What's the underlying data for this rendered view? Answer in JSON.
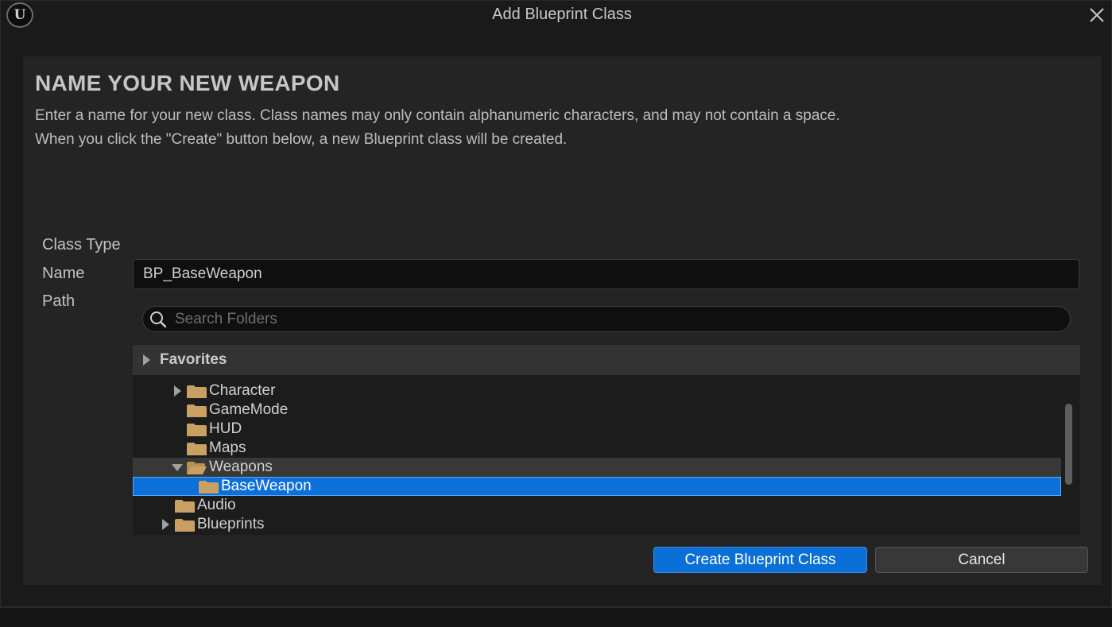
{
  "window": {
    "title": "Add Blueprint Class",
    "logo": "unreal-engine-logo",
    "logo_glyph": "U"
  },
  "content": {
    "heading": "NAME YOUR NEW WEAPON",
    "description_line1": "Enter a name for your new class. Class names may only contain alphanumeric characters, and may not contain a space.",
    "description_line2": "When you click the \"Create\" button below, a new Blueprint class will be created."
  },
  "form": {
    "class_type_label": "Class Type",
    "name_label": "Name",
    "name_value": "BP_BaseWeapon",
    "path_label": "Path",
    "search_placeholder": "Search Folders"
  },
  "tree": {
    "favorites_label": "Favorites",
    "items": [
      {
        "label": "Character",
        "expandable": true,
        "expanded": false
      },
      {
        "label": "GameMode",
        "expandable": false
      },
      {
        "label": "HUD",
        "expandable": false
      },
      {
        "label": "Maps",
        "expandable": false
      },
      {
        "label": "Weapons",
        "expandable": true,
        "expanded": true
      },
      {
        "label": "BaseWeapon",
        "expandable": false,
        "selected": true
      },
      {
        "label": "Audio",
        "expandable": false
      },
      {
        "label": "Blueprints",
        "expandable": true,
        "expanded": false
      }
    ]
  },
  "buttons": {
    "create_label": "Create Blueprint Class",
    "cancel_label": "Cancel"
  },
  "colors": {
    "accent": "#0a6fd6",
    "folder": "#c9a062",
    "background": "#242424"
  }
}
